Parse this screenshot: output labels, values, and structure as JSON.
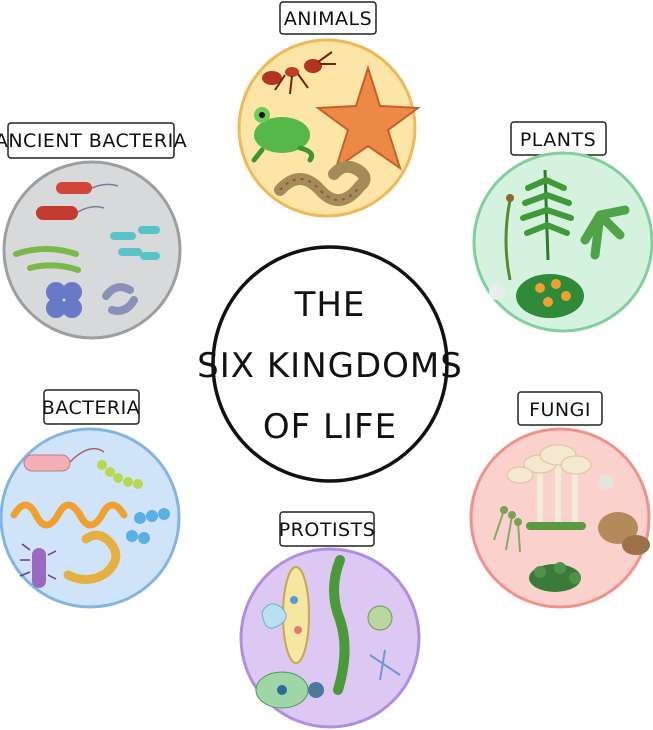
{
  "title": {
    "line1": "THE",
    "line2": "SIX KINGDOMS",
    "line3": "OF LIFE"
  },
  "kingdoms": [
    {
      "name": "ANIMALS",
      "color": "#fde5a8"
    },
    {
      "name": "PLANTS",
      "color": "#d5f2df"
    },
    {
      "name": "FUNGI",
      "color": "#fbd1cd"
    },
    {
      "name": "PROTISTS",
      "color": "#dcc8f2"
    },
    {
      "name": "BACTERIA",
      "color": "#cfe4f8"
    },
    {
      "name": "ANCIENT BACTERIA",
      "color": "#d8d9da"
    }
  ]
}
